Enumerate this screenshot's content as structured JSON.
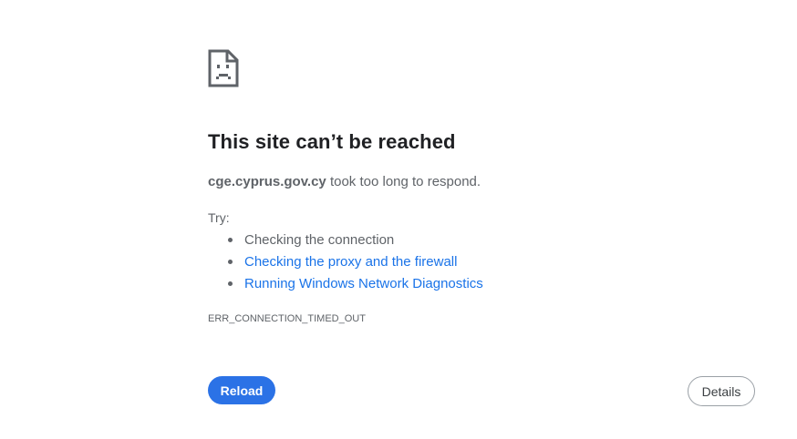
{
  "error_page": {
    "icon": "sad-document-icon",
    "title": "This site can’t be reached",
    "summary": {
      "host": "cge.cyprus.gov.cy",
      "message": "took too long to respond."
    },
    "try_label": "Try:",
    "suggestions": [
      {
        "label": "Checking the connection",
        "is_link": false
      },
      {
        "label": "Checking the proxy and the firewall",
        "is_link": true
      },
      {
        "label": "Running Windows Network Diagnostics",
        "is_link": true
      }
    ],
    "error_code": "ERR_CONNECTION_TIMED_OUT",
    "buttons": {
      "reload_label": "Reload",
      "details_label": "Details"
    }
  },
  "colors": {
    "accent": "#1a73e8",
    "reload_bg": "#2b72e6",
    "text_primary": "#202124",
    "text_secondary": "#5f6368"
  }
}
